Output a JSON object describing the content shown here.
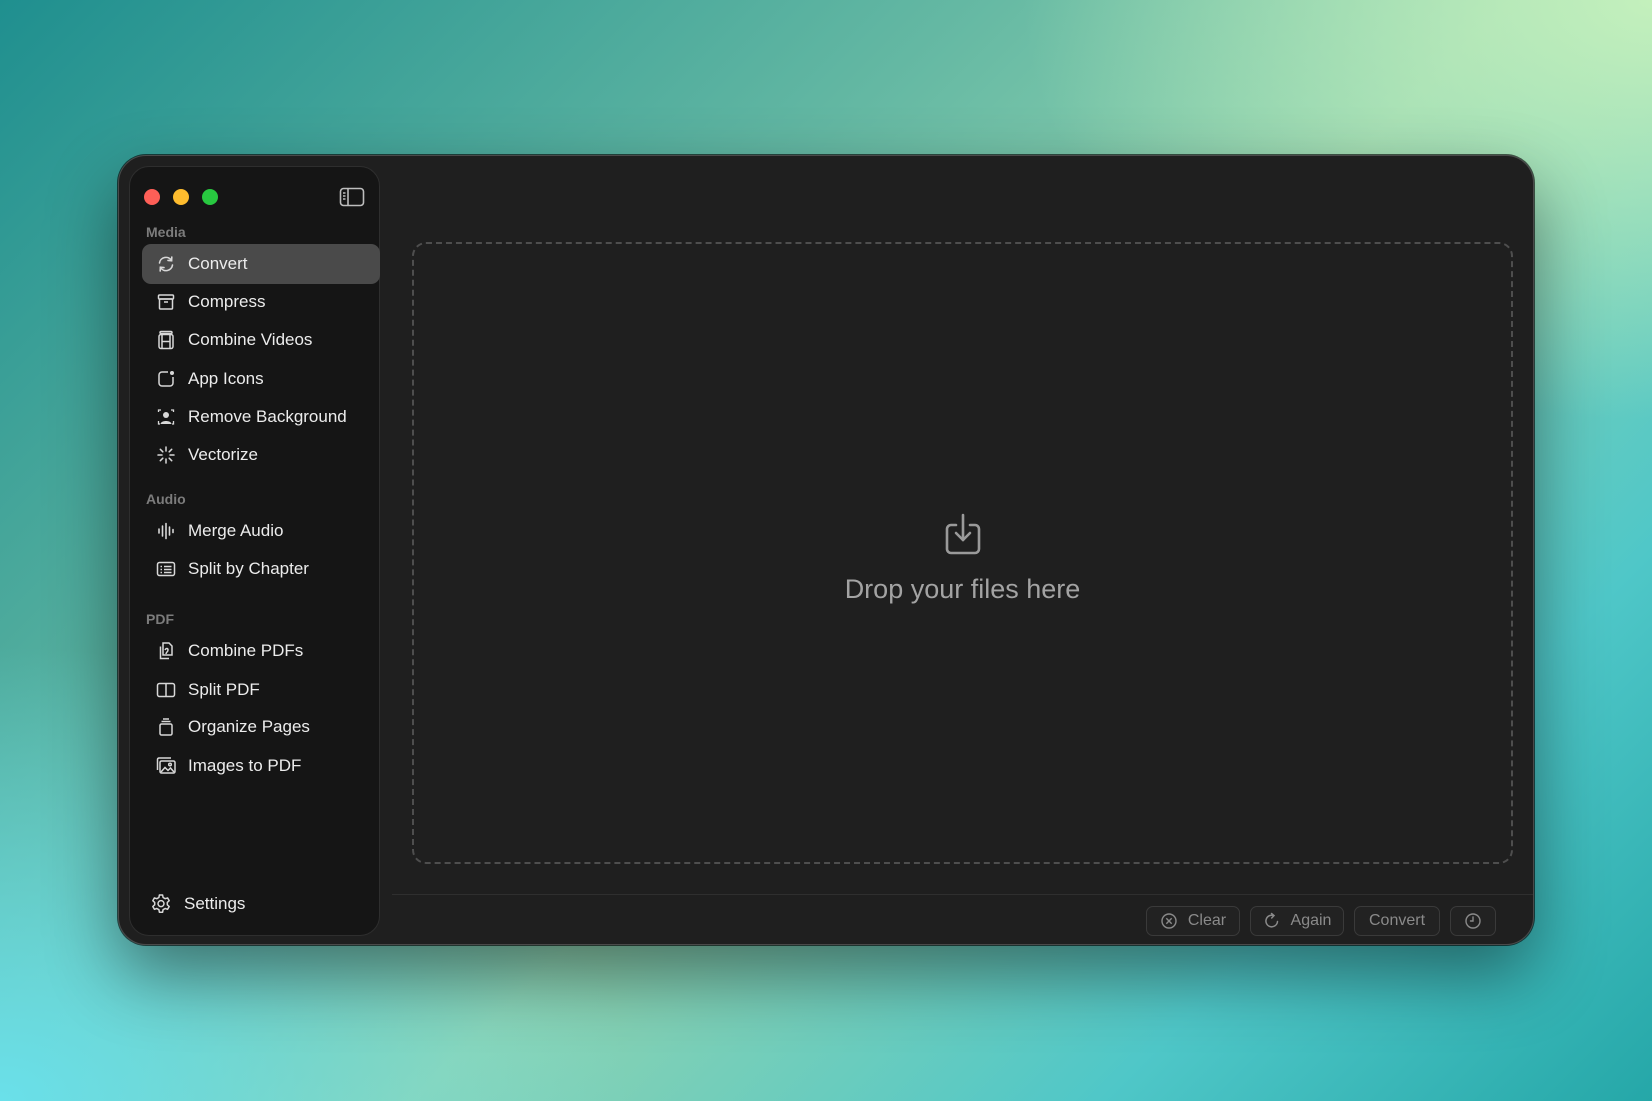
{
  "sidebar": {
    "sections": {
      "media": "Media",
      "audio": "Audio",
      "pdf": "PDF"
    },
    "items": {
      "convert": "Convert",
      "compress": "Compress",
      "combine_videos": "Combine Videos",
      "app_icons": "App Icons",
      "remove_background": "Remove Background",
      "vectorize": "Vectorize",
      "merge_audio": "Merge Audio",
      "split_by_chapter": "Split by Chapter",
      "combine_pdfs": "Combine PDFs",
      "split_pdf": "Split PDF",
      "organize_pages": "Organize Pages",
      "images_to_pdf": "Images to PDF"
    },
    "active_item": "convert",
    "settings_label": "Settings"
  },
  "dropzone": {
    "text": "Drop your files here",
    "icon": "tray-download-icon"
  },
  "footer": {
    "clear_label": "Clear",
    "again_label": "Again",
    "convert_label": "Convert",
    "history_icon": "clock-icon"
  },
  "colors": {
    "traffic_red": "#fe5f57",
    "traffic_yellow": "#febc2e",
    "traffic_green": "#28c840",
    "active_item_bg": "#4a4a4a",
    "window_bg": "#1f1f1f",
    "sidebar_bg": "#151515"
  }
}
